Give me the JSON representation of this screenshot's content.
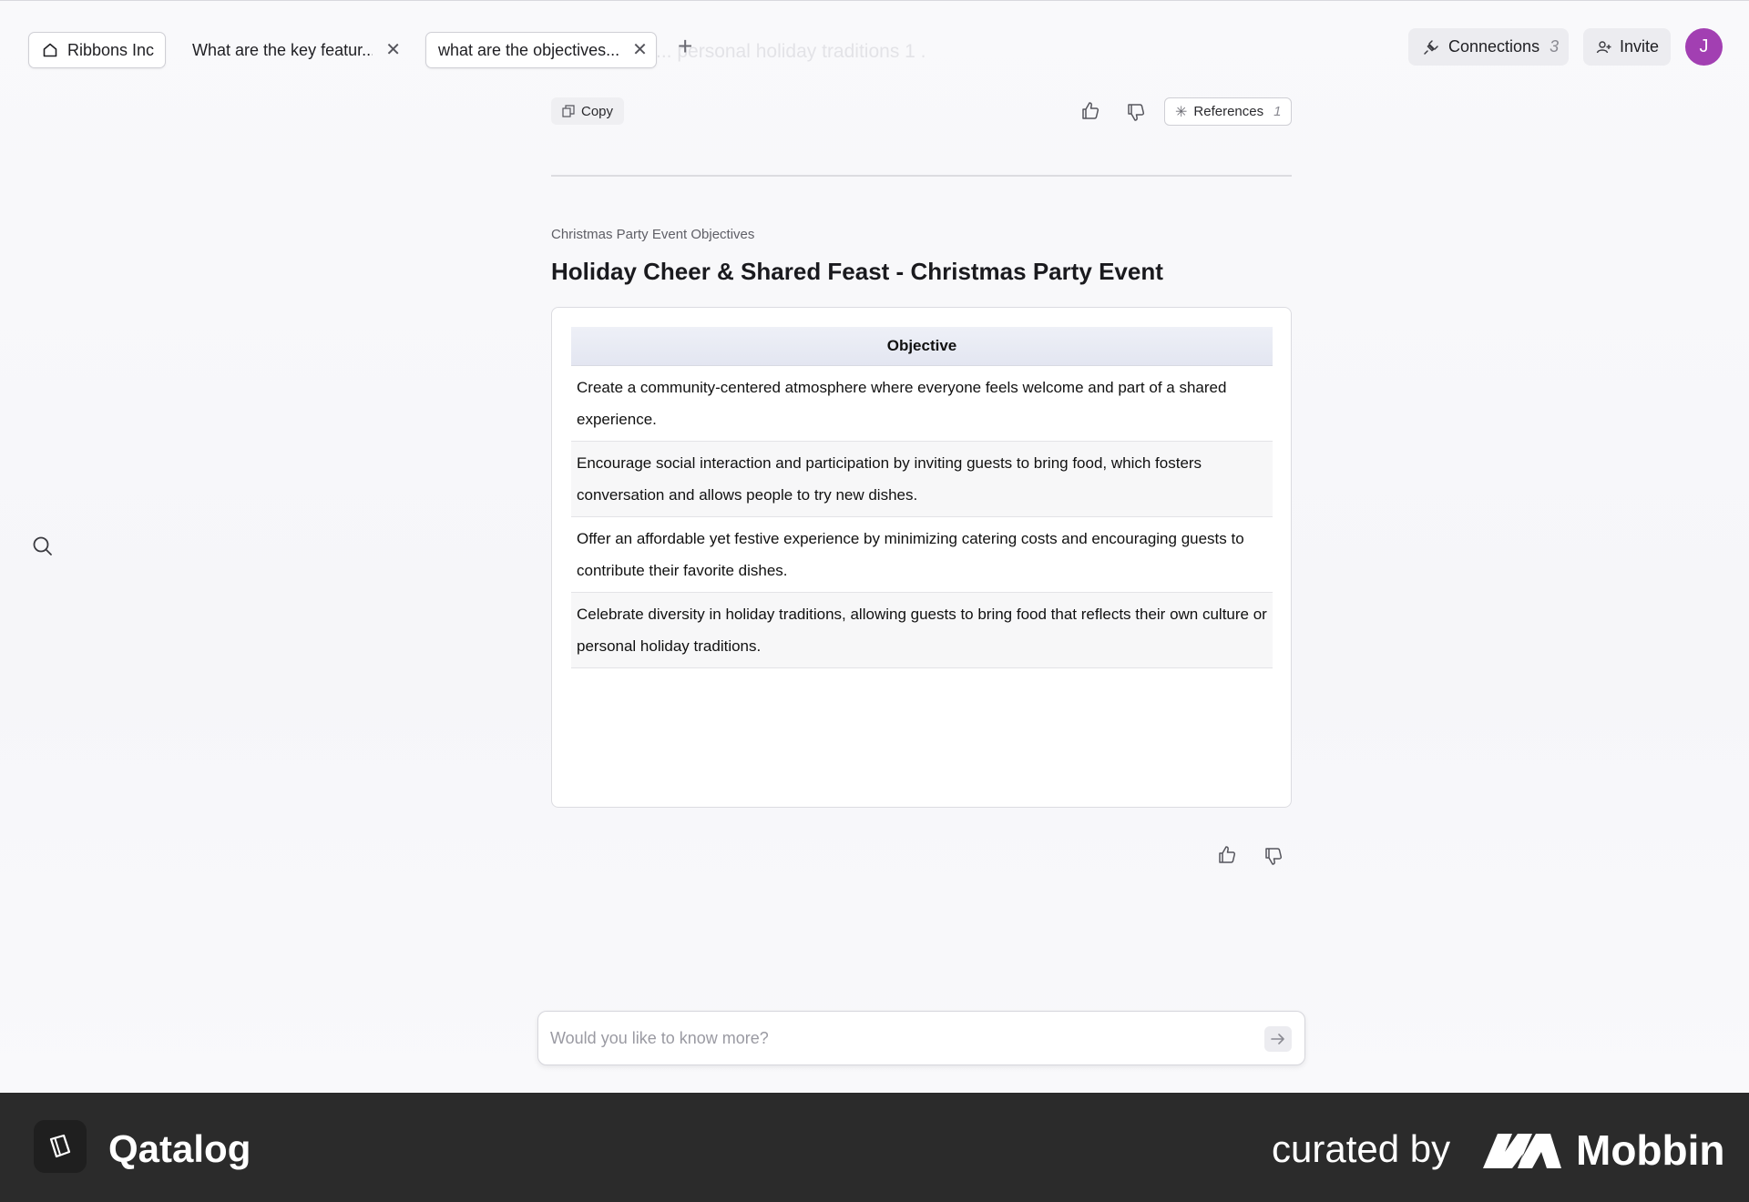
{
  "tabs": {
    "home_label": "Ribbons Inc",
    "tab1_label": "What are the key featur...",
    "tab2_label": "what are the objectives...",
    "ghost_text": "... personal holiday traditions 1 ."
  },
  "header": {
    "connections_label": "Connections",
    "connections_count": "3",
    "invite_label": "Invite",
    "avatar_initial": "J"
  },
  "message_toolbar": {
    "copy_label": "Copy",
    "references_label": "References",
    "references_count": "1"
  },
  "document": {
    "subtitle": "Christmas Party Event Objectives",
    "title": "Holiday Cheer & Shared Feast - Christmas Party Event",
    "table": {
      "header": "Objective",
      "rows": [
        "Create a community-centered atmosphere where everyone feels welcome and part of a shared experience.",
        "Encourage social interaction and participation by inviting guests to bring food, which fosters conversation and allows people to try new dishes.",
        "Offer an affordable yet festive experience by minimizing catering costs and encouraging guests to contribute their favorite dishes.",
        "Celebrate diversity in holiday traditions, allowing guests to bring food that reflects their own culture or personal holiday traditions."
      ]
    }
  },
  "chat": {
    "placeholder": "Would you like to know more?",
    "value": ""
  },
  "footer": {
    "brand": "Qatalog",
    "curated_label": "curated by",
    "partner": "Mobbin"
  }
}
